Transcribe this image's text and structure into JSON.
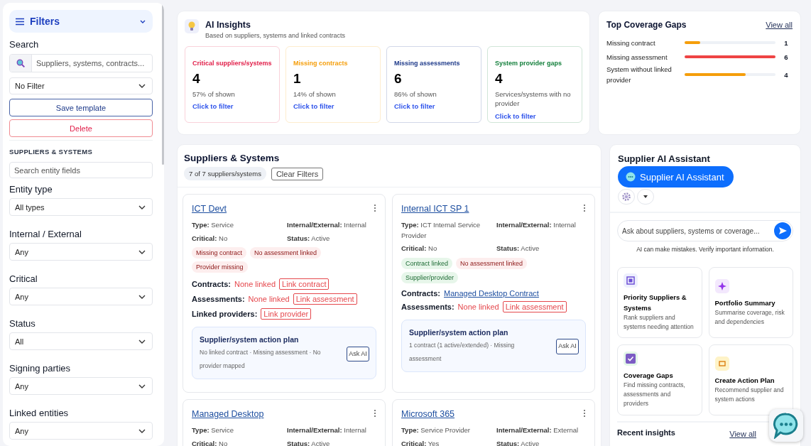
{
  "sidebar": {
    "title": "Filters",
    "search_label": "Search",
    "search_placeholder": "Suppliers, systems, contracts...",
    "template_select": "No Filter",
    "buttons": [
      {
        "label": "Save template",
        "kind": "primary"
      },
      {
        "label": "Delete",
        "kind": "danger"
      }
    ],
    "section_title": "SUPPLIERS & SYSTEMS",
    "entity_search_placeholder": "Search entity fields",
    "filters": [
      {
        "label": "Entity type",
        "value": "All types"
      },
      {
        "label": "Internal / External",
        "value": "Any"
      },
      {
        "label": "Critical",
        "value": "Any"
      },
      {
        "label": "Status",
        "value": "All"
      },
      {
        "label": "Signing parties",
        "value": "Any"
      },
      {
        "label": "Linked entities",
        "value": "Any"
      }
    ]
  },
  "insights": {
    "title": "AI Insights",
    "subtitle": "Based on suppliers, systems and linked contracts",
    "cards": [
      {
        "title": "Critical suppliers/systems",
        "value": "4",
        "note": "57% of shown",
        "link": "Click to filter",
        "color": "#e11d48"
      },
      {
        "title": "Missing contracts",
        "value": "1",
        "note": "14% of shown",
        "link": "Click to filter",
        "color": "#f59e0b"
      },
      {
        "title": "Missing assessments",
        "value": "6",
        "note": "86%  of shown",
        "link": "Click to filter",
        "color": "#1e3a8a"
      },
      {
        "title": "System provider gaps",
        "value": "4",
        "note": "Services/systems with no provider",
        "link": "Click to filter",
        "color": "#15803d"
      }
    ]
  },
  "coverage_gaps": {
    "title": "Top Coverage Gaps",
    "link": "View all",
    "items": [
      {
        "label": "Missing contract",
        "level": 0.17,
        "count": "1",
        "color": "#f59e0b"
      },
      {
        "label": "Missing assessment",
        "level": 1,
        "count": "6",
        "color": "#ef4444"
      },
      {
        "label": "System without linked provider",
        "level": 0.67,
        "count": "4",
        "color": "#f59e0b"
      }
    ]
  },
  "suppliers": {
    "title": "Suppliers & Systems",
    "count": "7 of 7 suppliers/systems",
    "clear_button": "Clear Filters",
    "cards": [
      {
        "name": "ICT Devt",
        "fields": [
          {
            "label": "Type:",
            "value": "Service"
          },
          {
            "label": "Internal/External:",
            "value": "Internal"
          },
          {
            "label": "Critical:",
            "value": "No"
          },
          {
            "label": "Status:",
            "value": "Active"
          }
        ],
        "tags": [
          {
            "label": "Missing contract",
            "kind": "bad"
          },
          {
            "label": "No assessment linked",
            "kind": "bad"
          },
          {
            "label": "Provider missing",
            "kind": "bad"
          }
        ],
        "links": [
          {
            "label": "Contracts:",
            "value": "None linked",
            "kind": "missing",
            "action": "Link contract"
          },
          {
            "label": "Assessments:",
            "value": "None linked",
            "kind": "missing",
            "action": "Link assessment"
          },
          {
            "label": "Linked providers:",
            "kind": "missing",
            "action": "Link provider"
          }
        ],
        "plan": {
          "title": "Supplier/system action plan",
          "text": "No linked contract · Missing assessment · No provider mapped",
          "button": "Ask AI"
        }
      },
      {
        "name": "Internal ICT SP 1",
        "fields": [
          {
            "label": "Type:",
            "value": "ICT Internal Service Provider"
          },
          {
            "label": "Internal/External:",
            "value": "Internal"
          },
          {
            "label": "Critical:",
            "value": "No"
          },
          {
            "label": "Status:",
            "value": "Active"
          }
        ],
        "tags": [
          {
            "label": "Contract linked",
            "kind": "good"
          },
          {
            "label": "No assessment linked",
            "kind": "bad"
          },
          {
            "label": "Supplier/provider",
            "kind": "good"
          }
        ],
        "links": [
          {
            "label": "Contracts:",
            "value": "Managed Desktop Contract",
            "kind": "link"
          },
          {
            "label": "Assessments:",
            "value": "None linked",
            "kind": "missing",
            "action": "Link assessment"
          }
        ],
        "plan": {
          "title": "Supplier/system action plan",
          "text": "1 contract (1 active/extended) · Missing assessment",
          "button": "Ask AI"
        }
      },
      {
        "name": "Managed Desktop",
        "fields": [
          {
            "label": "Type:",
            "value": "Service"
          },
          {
            "label": "Internal/External:",
            "value": "Internal"
          },
          {
            "label": "Critical:",
            "value": "No"
          },
          {
            "label": "Status:",
            "value": "Active"
          }
        ]
      },
      {
        "name": "Microsoft 365",
        "fields": [
          {
            "label": "Type:",
            "value": "Service Provider"
          },
          {
            "label": "Internal/External:",
            "value": "External"
          },
          {
            "label": "Critical:",
            "value": "Yes"
          },
          {
            "label": "Status:",
            "value": "Active"
          }
        ]
      }
    ]
  },
  "assistant": {
    "title": "Supplier AI Assistant",
    "button": "Supplier AI Assistant",
    "input_placeholder": "Ask about suppliers, systems or coverage...",
    "disclaimer": "AI can make mistakes. Verify important information.",
    "actions": [
      {
        "title": "Priority Suppliers & Systems",
        "description": "Rank suppliers and systems needing attention",
        "kind": "priority"
      },
      {
        "title": "Portfolio Summary",
        "description": "Summarise coverage, risk and dependencies",
        "kind": "summary"
      },
      {
        "title": "Coverage Gaps",
        "description": "Find missing contracts, assessments and providers",
        "kind": "gaps"
      },
      {
        "title": "Create Action Plan",
        "description": "Recommend supplier and system actions",
        "kind": "plan"
      }
    ],
    "recent_title": "Recent insights",
    "recent_link": "View all"
  }
}
